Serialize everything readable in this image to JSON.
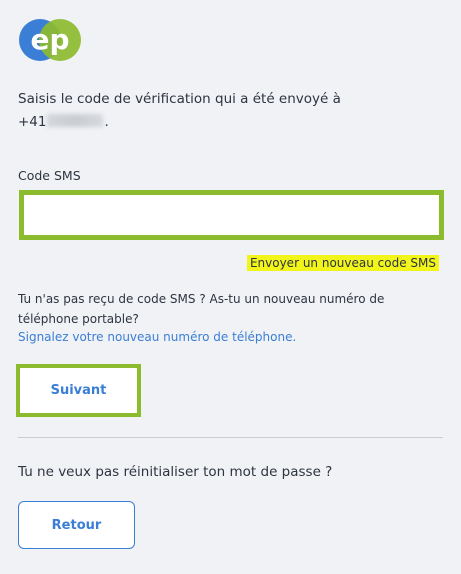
{
  "logo": {
    "text": "ep",
    "icon": "ep-logo-icon",
    "colors": {
      "blue": "#3b7ed6",
      "green": "#8dbb2e"
    }
  },
  "instruction": {
    "text": "Saisis le code de vérification qui a été envoyé à",
    "phone_prefix": "+41",
    "phone_suffix": "."
  },
  "sms_field": {
    "label": "Code SMS",
    "value": "",
    "placeholder": ""
  },
  "resend_link": "Envoyer un nouveau code SMS",
  "help": {
    "text": "Tu n'as pas reçu de code SMS ? As-tu un nouveau numéro de téléphone portable?",
    "link": "Signalez votre nouveau numéro de téléphone."
  },
  "next_button": "Suivant",
  "reset_question": "Tu ne veux pas réinitialiser ton mot de passe ?",
  "back_button": "Retour",
  "colors": {
    "accent_blue": "#3b7ed6",
    "highlight_green": "#8dbb2e",
    "highlight_yellow": "#f2f51a",
    "background": "#f0f2f5"
  }
}
